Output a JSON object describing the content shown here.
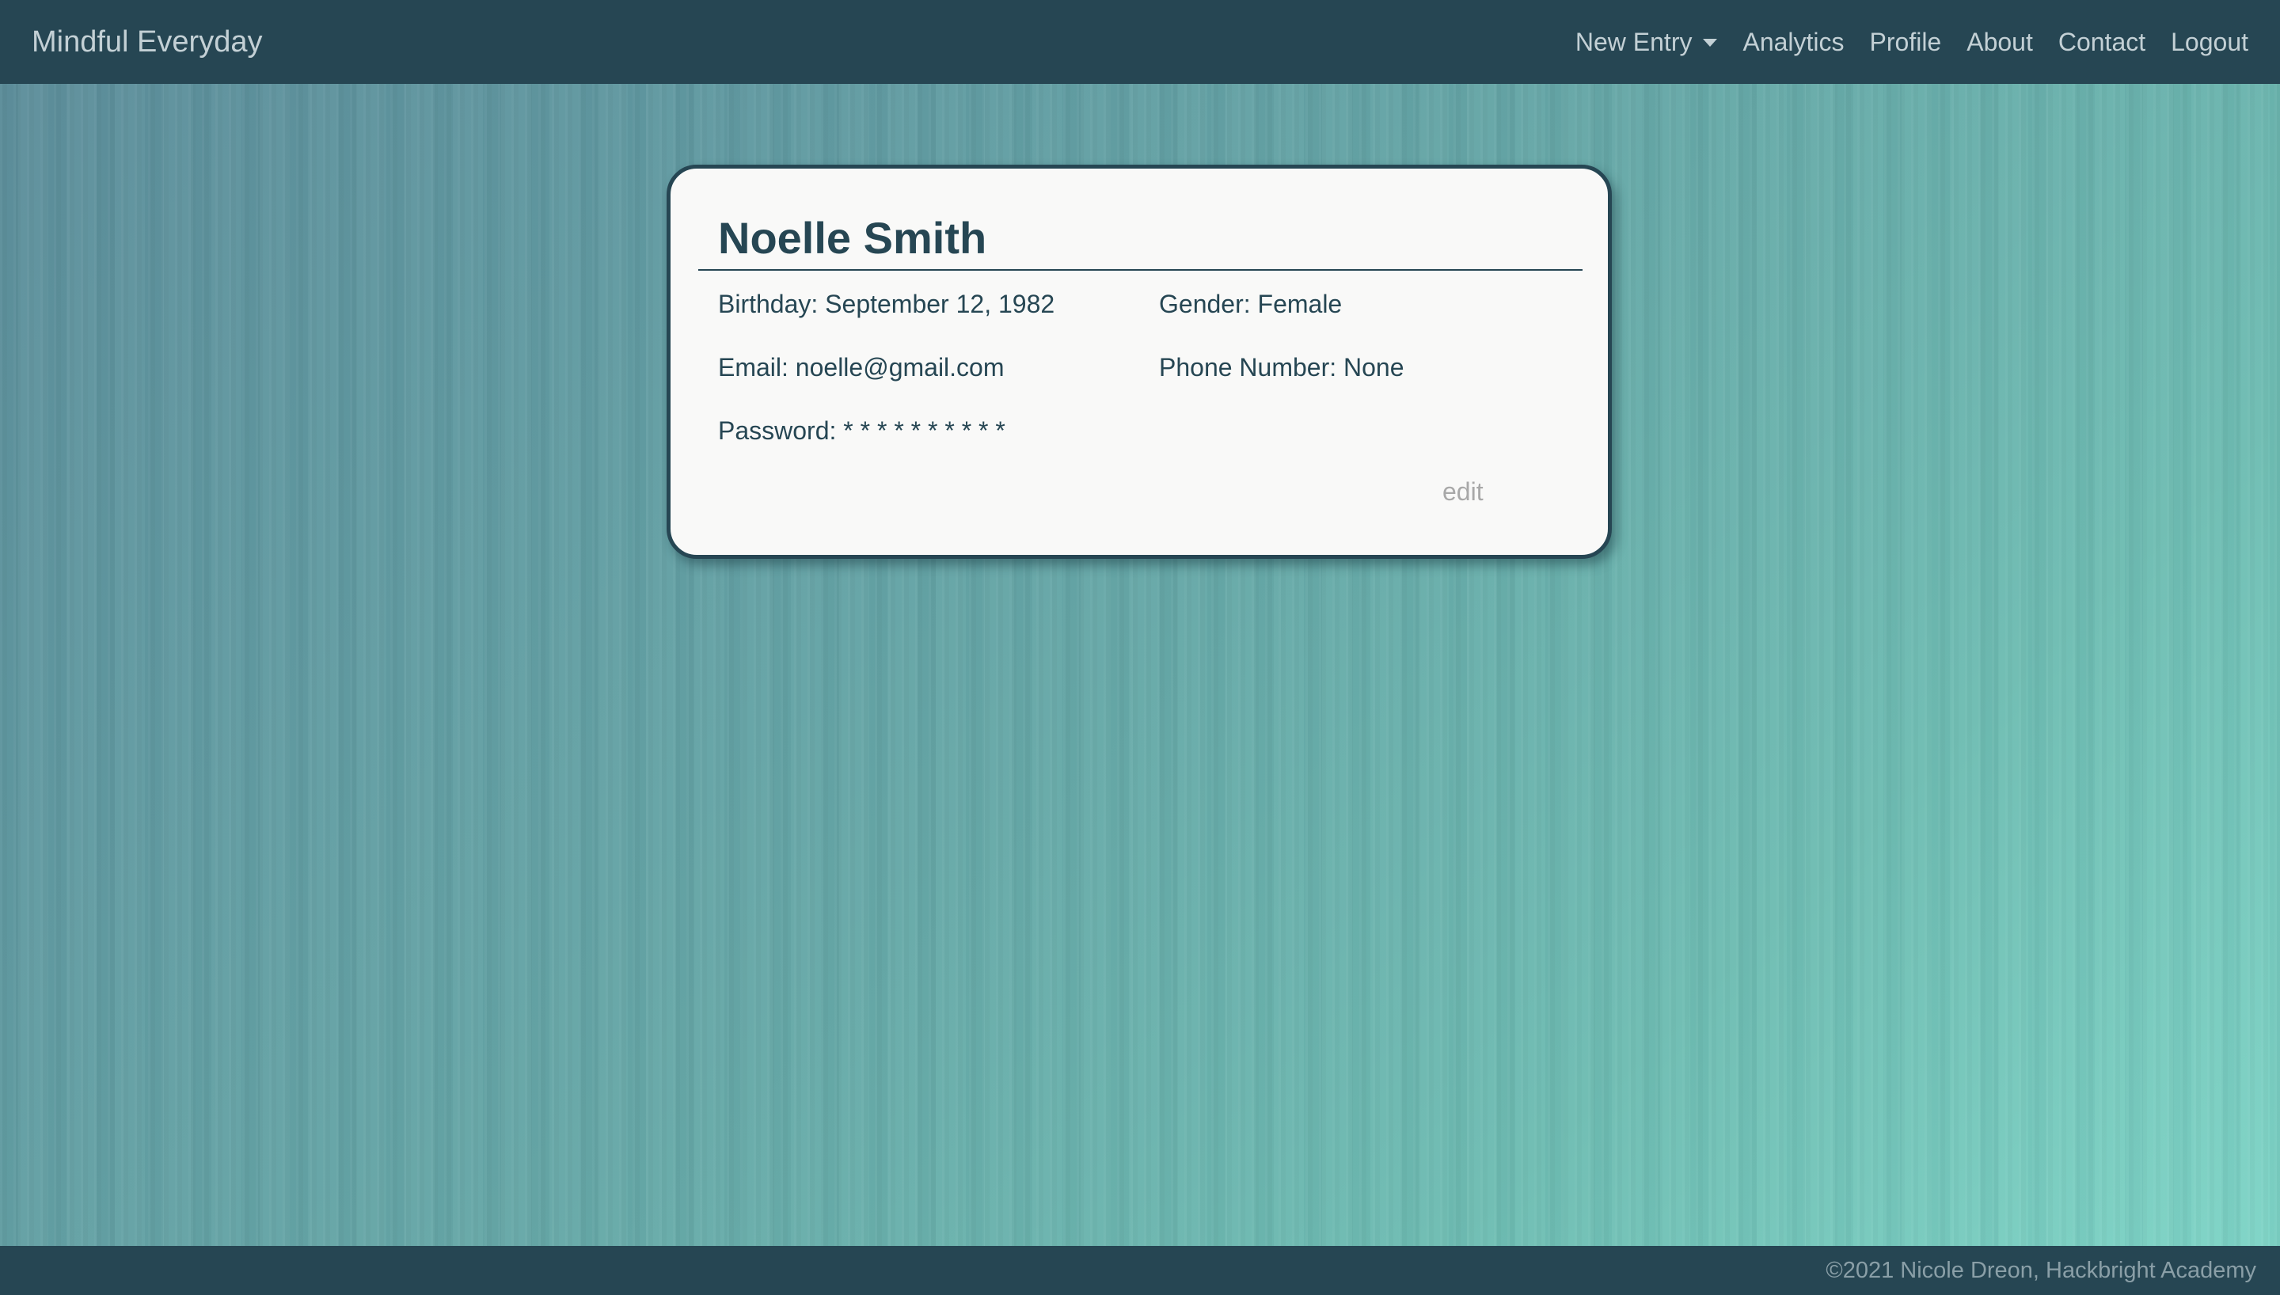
{
  "navbar": {
    "brand": "Mindful Everyday",
    "links": [
      {
        "label": "New Entry"
      },
      {
        "label": "Analytics"
      },
      {
        "label": "Profile"
      },
      {
        "label": "About"
      },
      {
        "label": "Contact"
      },
      {
        "label": "Logout"
      }
    ]
  },
  "profile": {
    "name": "Noelle Smith",
    "birthday": "Birthday: September 12, 1982",
    "gender": "Gender: Female",
    "email": "Email: noelle@gmail.com",
    "phone": "Phone Number: None",
    "password": "Password: * * * * * * * * * *",
    "edit_label": "edit"
  },
  "footer": {
    "text": "©2021 Nicole Dreon, Hackbright Academy"
  },
  "colors": {
    "navbar_bg": "#264653",
    "card_border": "#264653",
    "text_primary": "#264653",
    "nav_text": "#c3d0d5",
    "edit_text": "#a8a8a8",
    "card_bg": "#f9f9f8"
  },
  "icons": {
    "dropdown": "caret-down-icon"
  }
}
